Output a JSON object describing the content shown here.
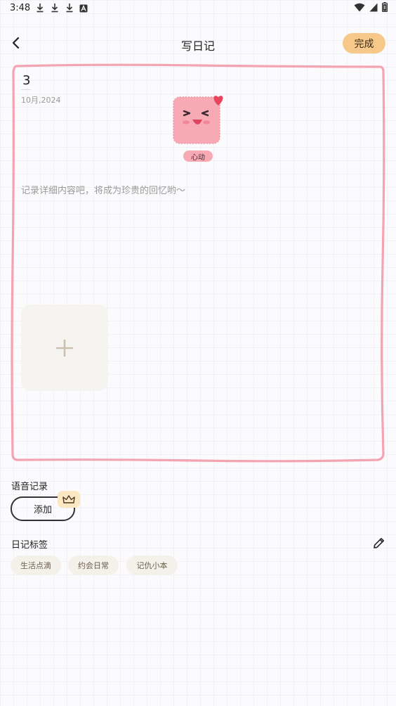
{
  "status_bar": {
    "time": "3:48",
    "left_icons": [
      "download-icon",
      "download-icon",
      "download-icon",
      "font-icon"
    ],
    "right_icons": [
      "wifi-icon",
      "signal-icon",
      "battery-icon"
    ]
  },
  "header": {
    "title": "写日记",
    "done_label": "完成"
  },
  "diary": {
    "day": "3",
    "date": "10月,2024",
    "mood_label": "心动",
    "placeholder": "记录详细内容吧，将成为珍贵的回忆哟～",
    "add_photo_icon": "plus-icon"
  },
  "voice": {
    "label": "语音记录",
    "add_label": "添加",
    "badge_icon": "crown-icon"
  },
  "tags": {
    "label": "日记标签",
    "edit_icon": "pencil-icon",
    "items": [
      "生活点滴",
      "约会日常",
      "记仇小本"
    ]
  },
  "colors": {
    "accent": "#f6c98a",
    "card_border": "#f4a3b0",
    "mood_pink": "#f7a9b4",
    "chip_bg": "#f4f0ea"
  }
}
